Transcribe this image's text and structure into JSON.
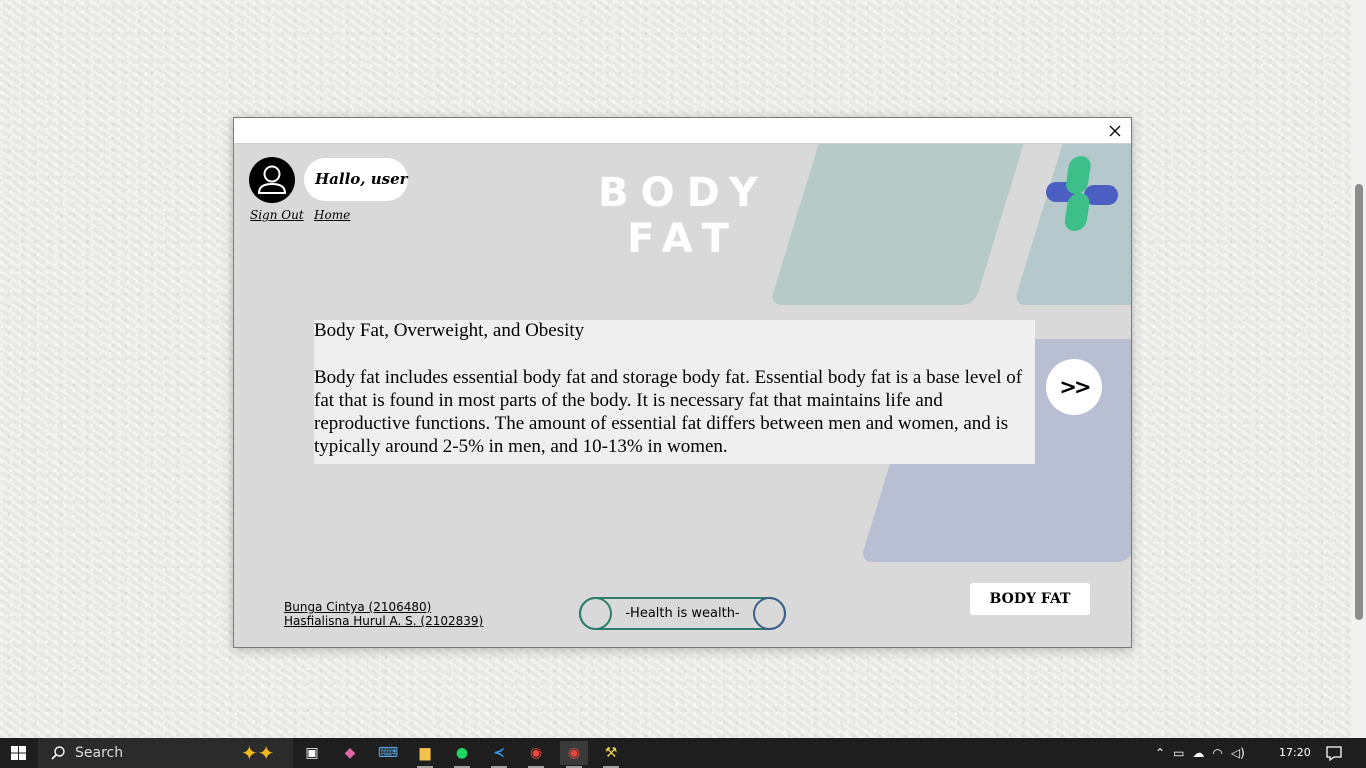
{
  "window": {
    "close_symbol": "×",
    "greeting": "Hallo, user",
    "links": {
      "sign_out": "Sign Out",
      "home": "Home"
    },
    "page_title": "BODY FAT",
    "article": {
      "heading": "Body Fat, Overweight, and Obesity",
      "body": "Body fat includes essential body fat and storage body fat. Essential body fat is a base level of fat that is found in most parts of the body. It is necessary fat that maintains life and reproductive functions. The amount of essential fat differs between men and women, and is typically around 2-5% in men, and 10-13% in women."
    },
    "next_button": ">>",
    "credits": [
      "Bunga Cintya (2106480)",
      "Hasfialisna Hurul A. S. (2102839)"
    ],
    "motto": "-Health is wealth-",
    "section_button": "BODY FAT",
    "colors": {
      "background": "#d9d9d9",
      "logo_green": "#3dbf8a",
      "logo_blue": "#4a5fc1",
      "shape_green": "#b6cbc8",
      "shape_blue": "#b9bfd2"
    },
    "icons": {
      "avatar": "user-avatar-icon",
      "logo": "medical-cross-logo",
      "close": "close-icon"
    }
  },
  "taskbar": {
    "search_placeholder": "Search",
    "apps": [
      "task-view-icon",
      "copilot-icon",
      "keyboard-icon",
      "file-explorer-icon",
      "spotify-icon",
      "vscode-icon",
      "chrome-icon",
      "chrome-active-icon",
      "tool-app-icon"
    ],
    "clock": "17:20"
  }
}
